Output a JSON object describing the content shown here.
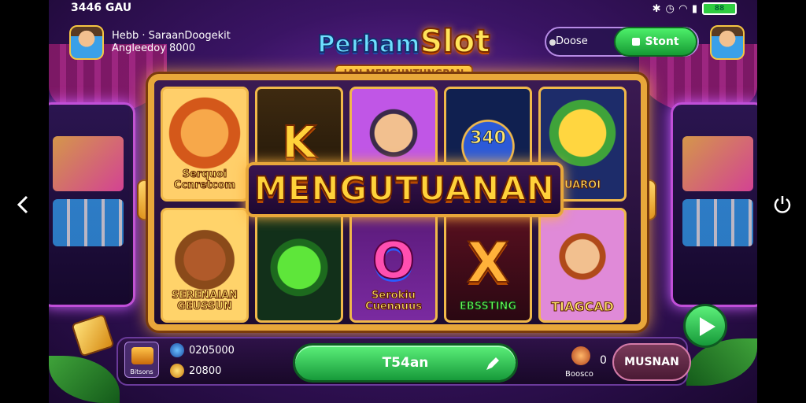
{
  "status_bar": {
    "time": "3446",
    "carrier": "GAU",
    "battery": "88"
  },
  "header": {
    "player_name": "Hebb · SaraanDoogekit",
    "player_balance": "Angleedoy 8000",
    "logo_title": "PerhamSlot",
    "logo_title_part1": "Perham",
    "logo_title_part2": "Slot",
    "logo_subtitle": "IAN MENGUNTUNGPAN",
    "currency_label": "Doose",
    "store_label": "Stont"
  },
  "reels": {
    "tiles": [
      {
        "caption": "Serquoi Ccnretcom",
        "symbol": ""
      },
      {
        "caption": "",
        "symbol": "K"
      },
      {
        "caption": "",
        "symbol": ""
      },
      {
        "caption": "",
        "symbol": "340"
      },
      {
        "caption": "UAROI",
        "symbol": ""
      },
      {
        "caption": "SERENAIAN GEUSSUN",
        "symbol": ""
      },
      {
        "caption": "",
        "symbol": ""
      },
      {
        "caption": "Serokiu Cuenauus",
        "symbol": "O"
      },
      {
        "caption": "EBSSTING",
        "symbol": "X"
      },
      {
        "caption": "TIAGCAD",
        "symbol": ""
      }
    ],
    "banner": "MENGUTUANAN"
  },
  "bottom_bar": {
    "chest_label": "Bitsons",
    "stat_gems": "0205000",
    "stat_coins": "20800",
    "spin_label": "T54an",
    "bonus_count": "0",
    "bonus_label": "Boosco",
    "action_label": "MUSNAN"
  },
  "icons": {
    "back": "chevron-left-icon",
    "power": "power-icon",
    "play": "play-icon",
    "store": "store-icon",
    "chest": "treasure-chest-icon"
  },
  "colors": {
    "accent": "#e8a73a",
    "button_green": "#2ecc40",
    "background": "#3a1464"
  }
}
